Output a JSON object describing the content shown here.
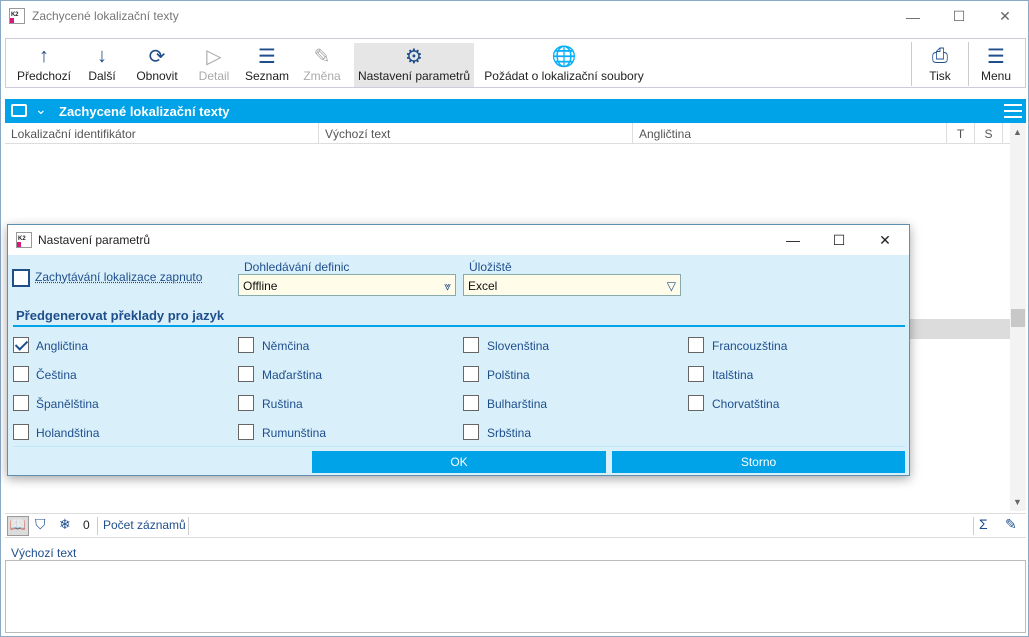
{
  "window": {
    "title": "Zachycené lokalizační texty",
    "minimize": "—",
    "maximize": "☐",
    "close": "✕",
    "logo_text": "K2"
  },
  "toolbar": {
    "items": [
      {
        "label": "Předchozí",
        "icon": "↑"
      },
      {
        "label": "Další",
        "icon": "↓"
      },
      {
        "label": "Obnovit",
        "icon": "⟳"
      },
      {
        "label": "Detail",
        "icon": "▷"
      },
      {
        "label": "Seznam",
        "icon": "☰"
      },
      {
        "label": "Změna",
        "icon": "✎"
      },
      {
        "label": "Nastavení parametrů",
        "icon": "⚙"
      },
      {
        "label": "Požádat o lokalizační soubory",
        "icon": "🌐"
      },
      {
        "label": "Tisk",
        "icon": "⎙"
      },
      {
        "label": "Menu",
        "icon": "☰"
      }
    ]
  },
  "grid": {
    "title": "Zachycené lokalizační texty",
    "columns": [
      "Lokalizační identifikátor",
      "Výchozí text",
      "Angličtina",
      "T",
      "S"
    ]
  },
  "statusbar": {
    "count": "0",
    "record_count_label": "Počet záznamů"
  },
  "detail": {
    "label": "Výchozí text"
  },
  "dialog": {
    "title": "Nastavení parametrů",
    "capture_label": "Zachytávání lokalizace zapnuto",
    "lookup_label": "Dohledávání definic",
    "lookup_value": "Offline",
    "storage_label": "Úložiště",
    "storage_value": "Excel",
    "section_title": "Předgenerovat překlady pro jazyk",
    "languages": [
      {
        "label": "Angličtina",
        "checked": true
      },
      {
        "label": "Němčina",
        "checked": false
      },
      {
        "label": "Slovenština",
        "checked": false
      },
      {
        "label": "Francouzština",
        "checked": false
      },
      {
        "label": "Čeština",
        "checked": false
      },
      {
        "label": "Maďarština",
        "checked": false
      },
      {
        "label": "Polština",
        "checked": false
      },
      {
        "label": "Italština",
        "checked": false
      },
      {
        "label": "Španělština",
        "checked": false
      },
      {
        "label": "Ruština",
        "checked": false
      },
      {
        "label": "Bulharština",
        "checked": false
      },
      {
        "label": "Chorvatština",
        "checked": false
      },
      {
        "label": "Holandština",
        "checked": false
      },
      {
        "label": "Rumunština",
        "checked": false
      },
      {
        "label": "Srbština",
        "checked": false
      }
    ],
    "ok_label": "OK",
    "cancel_label": "Storno"
  }
}
